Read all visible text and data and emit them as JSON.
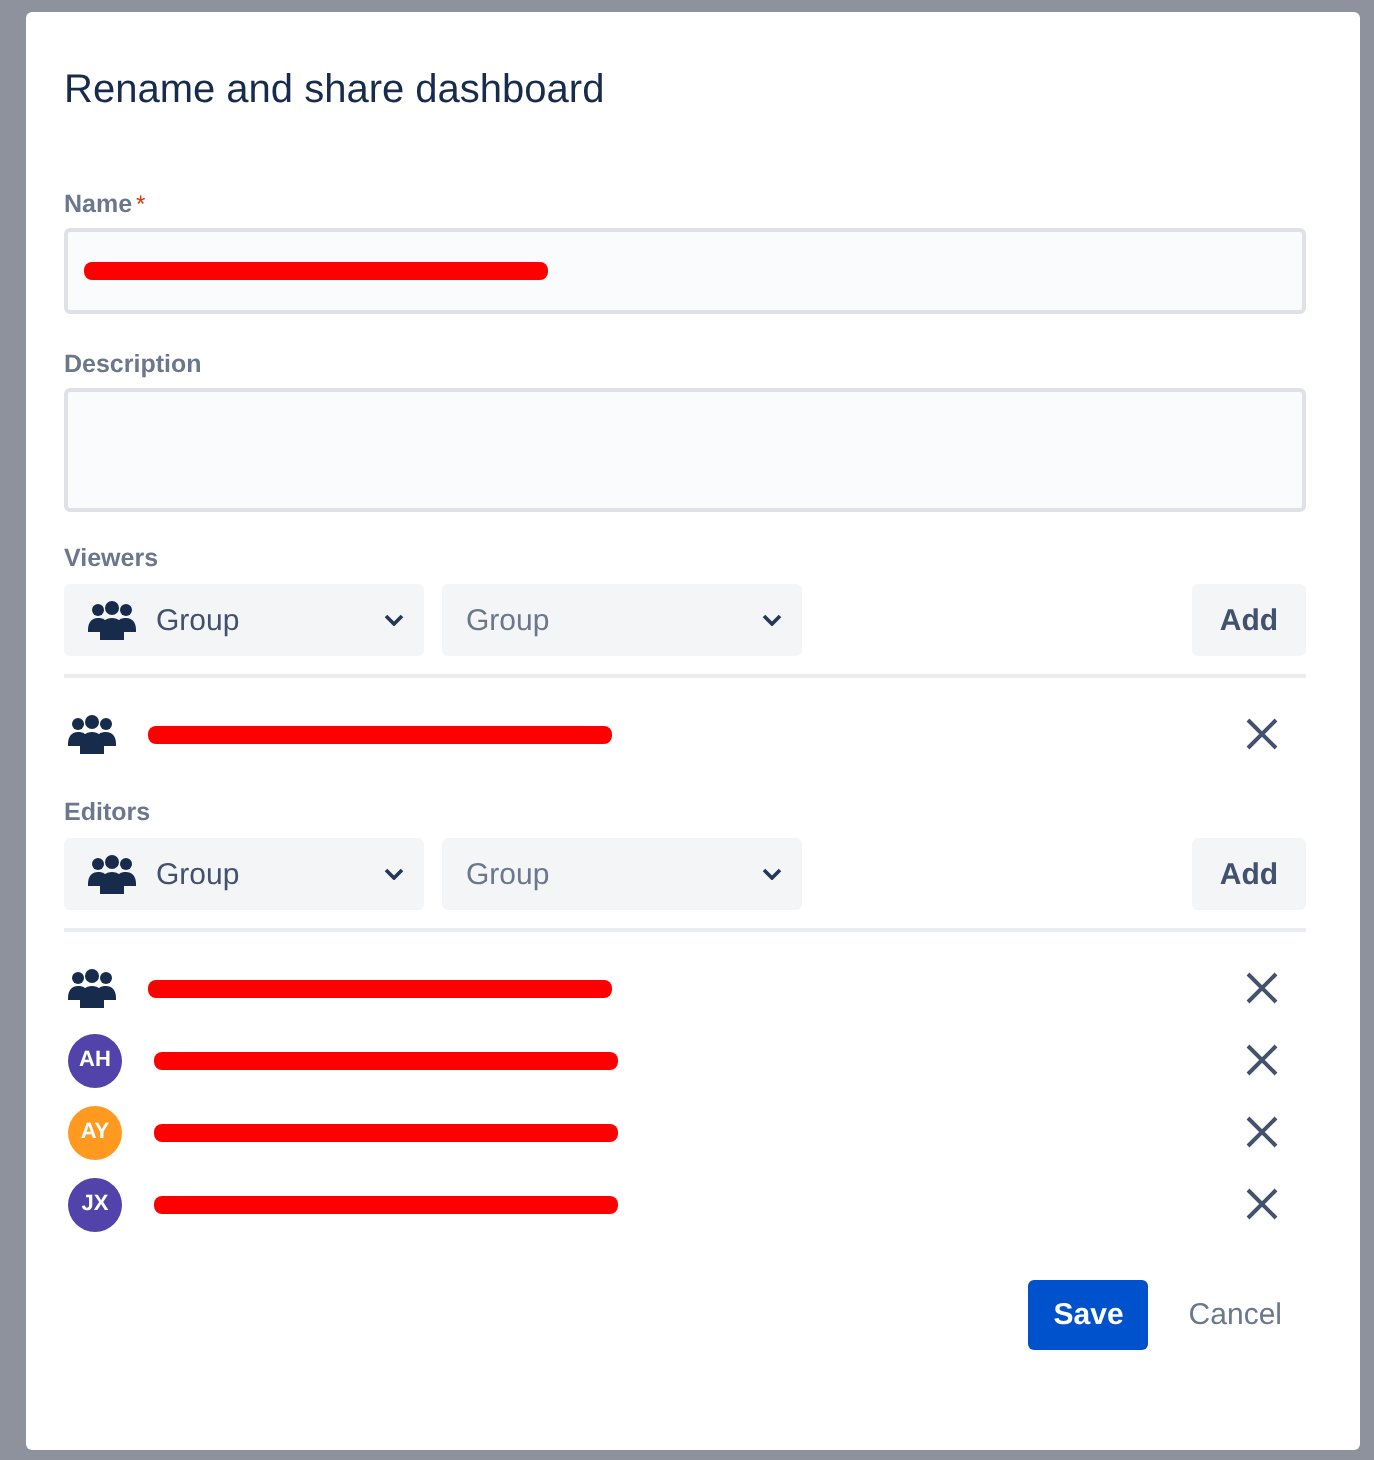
{
  "dialog": {
    "title": "Rename and share dashboard"
  },
  "name_field": {
    "label": "Name",
    "required": true,
    "required_marker": "*",
    "redacted": true
  },
  "description_field": {
    "label": "Description"
  },
  "viewers": {
    "label": "Viewers",
    "type_select": "Group",
    "value_select": {
      "placeholder": "Group"
    },
    "add_button": "Add",
    "entries": [
      {
        "kind": "group",
        "redacted": true
      }
    ]
  },
  "editors": {
    "label": "Editors",
    "type_select": "Group",
    "value_select": {
      "placeholder": "Group"
    },
    "add_button": "Add",
    "entries": [
      {
        "kind": "group",
        "redacted": true
      },
      {
        "kind": "user",
        "initials": "AH",
        "color": "#5243aa",
        "redacted": true
      },
      {
        "kind": "user",
        "initials": "AY",
        "color": "#ff991f",
        "redacted": true
      },
      {
        "kind": "user",
        "initials": "JX",
        "color": "#5243aa",
        "redacted": true
      }
    ]
  },
  "buttons": {
    "save": "Save",
    "cancel": "Cancel"
  }
}
